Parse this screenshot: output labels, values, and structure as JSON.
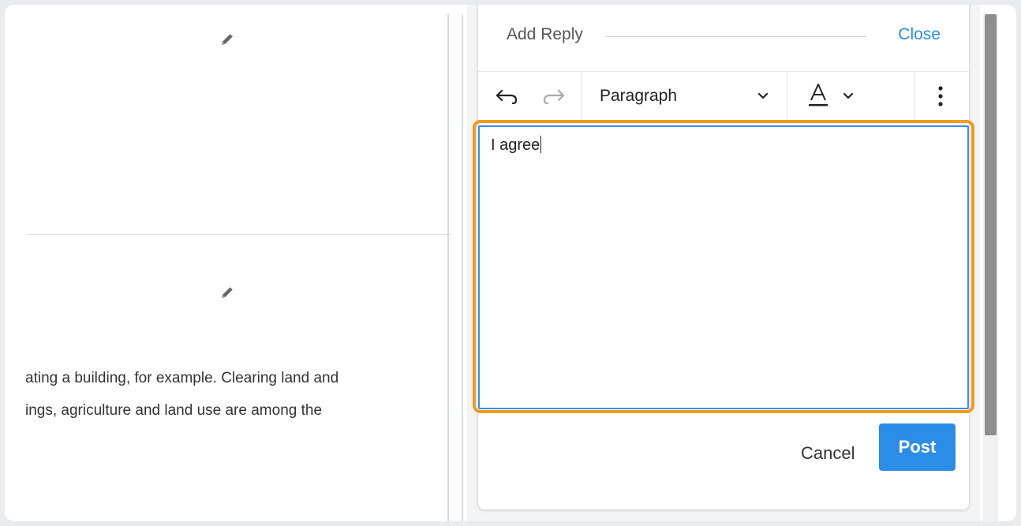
{
  "left_pane": {
    "text_lines": [
      "ating a building, for example. Clearing land and",
      "ings, agriculture and land use are among the"
    ]
  },
  "reply_panel": {
    "title": "Add Reply",
    "close_label": "Close",
    "toolbar": {
      "block_format": "Paragraph",
      "undo_icon": "undo-icon",
      "redo_icon": "redo-icon",
      "text_color_icon": "text-color-icon",
      "more_icon": "more-vertical-icon"
    },
    "editor": {
      "content": "I agree"
    },
    "cancel_label": "Cancel",
    "post_label": "Post"
  },
  "colors": {
    "accent": "#2b8de6",
    "highlight": "#f39a1b"
  }
}
